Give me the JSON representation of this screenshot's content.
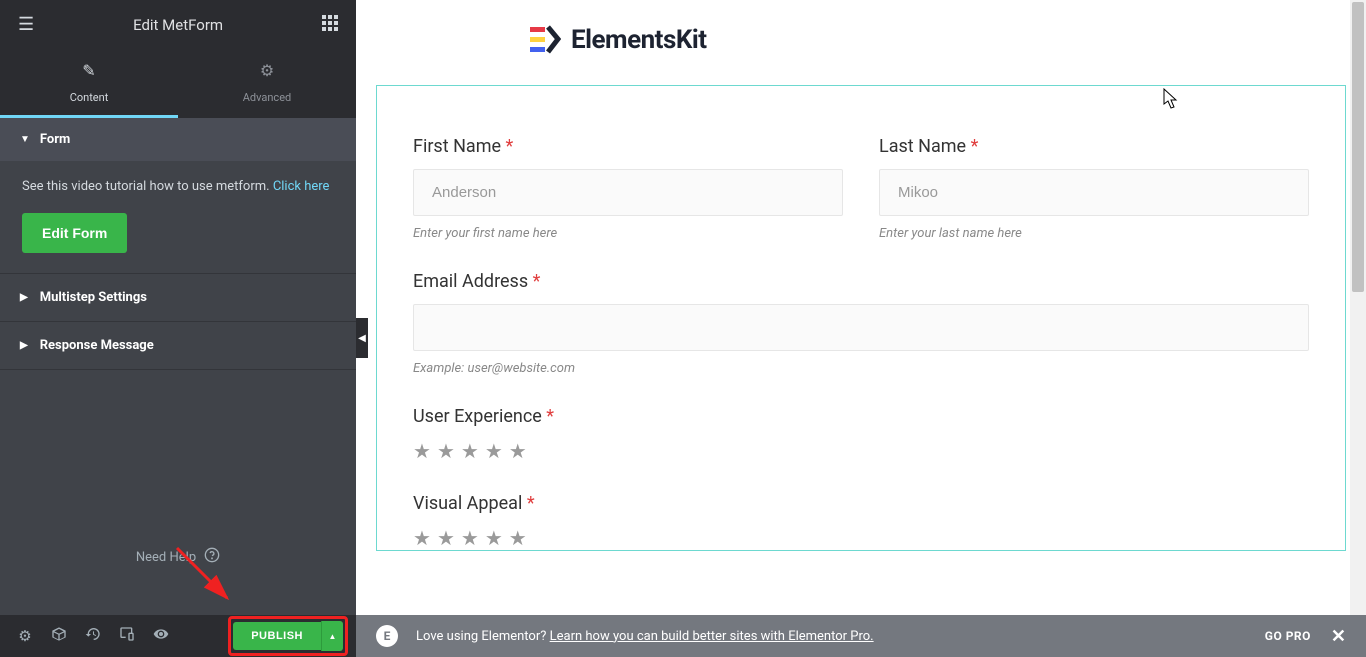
{
  "sidebar": {
    "title": "Edit MetForm",
    "tabs": {
      "content": "Content",
      "advanced": "Advanced"
    },
    "form_heading": "Form",
    "tutorial_text": "See this video tutorial how to use metform. ",
    "tutorial_link": "Click here",
    "edit_form_btn": "Edit Form",
    "multistep": "Multistep Settings",
    "response": "Response Message",
    "need_help": "Need Help",
    "publish": "PUBLISH"
  },
  "logo": {
    "text": "ElementsKit"
  },
  "form": {
    "first_name": {
      "label": "First Name",
      "placeholder": "Anderson",
      "help": "Enter your first name here"
    },
    "last_name": {
      "label": "Last Name",
      "placeholder": "Mikoo",
      "help": "Enter your last name here"
    },
    "email": {
      "label": "Email Address",
      "help": "Example: user@website.com"
    },
    "ux": {
      "label": "User Experience"
    },
    "visual": {
      "label": "Visual Appeal"
    }
  },
  "promo": {
    "text": "Love using Elementor? ",
    "link": "Learn how you can build better sites with Elementor Pro.",
    "go_pro": "GO PRO"
  }
}
